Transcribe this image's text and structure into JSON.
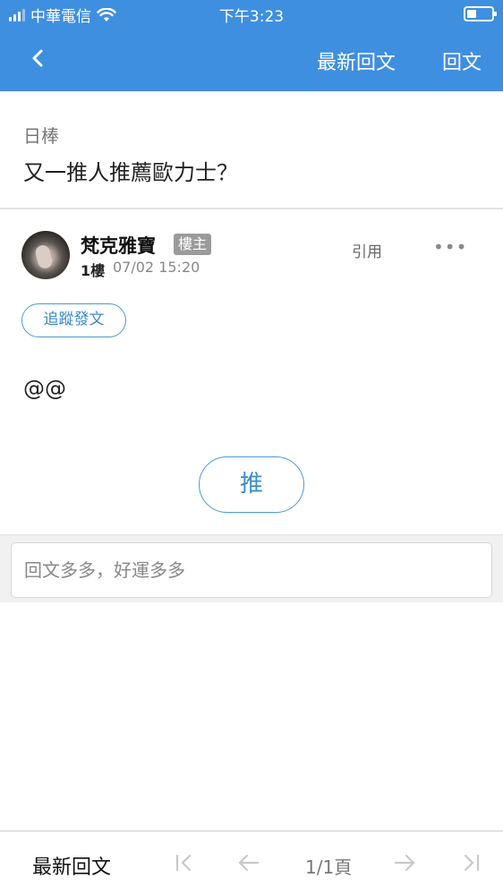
{
  "status_bar": {
    "carrier": "中華電信",
    "time": "下午3:23"
  },
  "nav": {
    "latest_label": "最新回文",
    "reply_label": "回文"
  },
  "thread": {
    "board": "日棒",
    "title": "又一推人推薦歐力士？"
  },
  "post": {
    "author": "梵克雅寶",
    "op_badge": "樓主",
    "floor": "1樓",
    "time": "07/02 15:20",
    "quote_label": "引用",
    "more_label": "•••",
    "follow_label": "追蹤發文",
    "content": "@@",
    "push_label": "推"
  },
  "reply": {
    "placeholder": "回文多多，好運多多"
  },
  "bottom": {
    "latest_label": "最新回文",
    "page_info": "1/1頁"
  },
  "colors": {
    "header_bg": "#3f8fe0",
    "accent": "#4a9ad6",
    "badge": "#9b9b9b"
  }
}
